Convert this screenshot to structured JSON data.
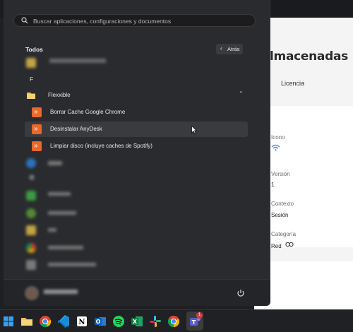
{
  "background_app": {
    "title": "lmacenadas",
    "tab": "Licencia",
    "fields": [
      {
        "label": "Icono",
        "value": ""
      },
      {
        "label": "Versión",
        "value": "1"
      },
      {
        "label": "Contexto",
        "value": "Sesión"
      },
      {
        "label": "Categoría",
        "value": "Red"
      }
    ]
  },
  "start_menu": {
    "search_placeholder": "Buscar aplicaciones, configuraciones y documentos",
    "section_title": "Todos",
    "back_label": "Atrás",
    "letter_f": "F",
    "group_name": "Flexxible",
    "group_items": [
      "Borrar Cache Google Chrome",
      "Desinstalar AnyDesk",
      "Limpiar disco (incluye caches de Spotify)"
    ]
  },
  "colors": {
    "accent_orange": "#e8692a",
    "folder_yellow": "#f2c14e",
    "menu_bg": "#2a2b2e",
    "taskbar_bg": "#202124"
  },
  "taskbar": {
    "notification_count": "1",
    "items": [
      "windows-start-icon",
      "file-explorer-icon",
      "chrome-icon",
      "vscode-icon",
      "notion-icon",
      "outlook-icon",
      "spotify-icon",
      "excel-icon",
      "slack-icon",
      "chrome-alt-icon",
      "teams-icon"
    ]
  }
}
